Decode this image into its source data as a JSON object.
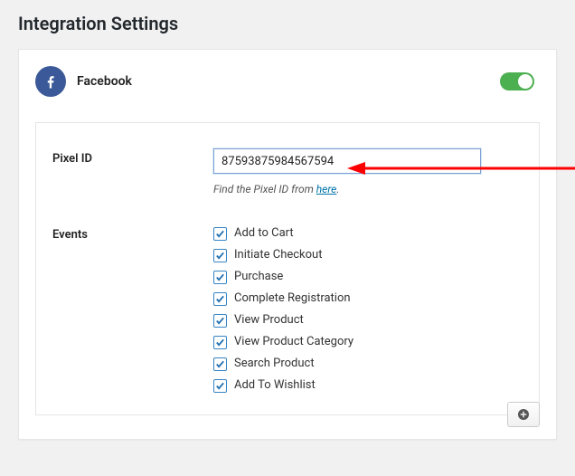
{
  "page_title": "Integration Settings",
  "integration": {
    "name": "Facebook",
    "enabled": true,
    "pixel_id_label": "Pixel ID",
    "pixel_id_value": "87593875984567594",
    "help_prefix": "Find the Pixel ID from ",
    "help_link_text": "here",
    "help_suffix": ".",
    "events_label": "Events",
    "events": [
      {
        "id": "add-to-cart",
        "label": "Add to Cart",
        "checked": true
      },
      {
        "id": "initiate-checkout",
        "label": "Initiate Checkout",
        "checked": true
      },
      {
        "id": "purchase",
        "label": "Purchase",
        "checked": true
      },
      {
        "id": "complete-registration",
        "label": "Complete Registration",
        "checked": true
      },
      {
        "id": "view-product",
        "label": "View Product",
        "checked": true
      },
      {
        "id": "view-product-category",
        "label": "View Product Category",
        "checked": true
      },
      {
        "id": "search-product",
        "label": "Search Product",
        "checked": true
      },
      {
        "id": "add-to-wishlist",
        "label": "Add To Wishlist",
        "checked": true
      }
    ]
  }
}
